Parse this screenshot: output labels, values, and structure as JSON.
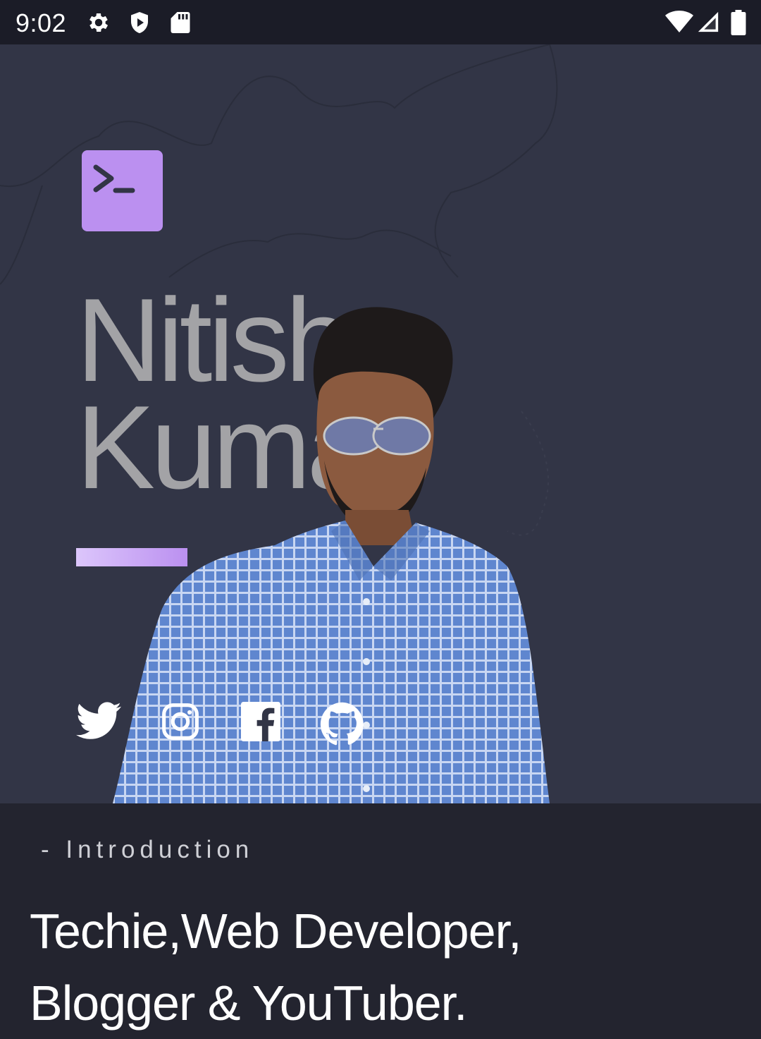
{
  "status_bar": {
    "time": "9:02",
    "icons": [
      "settings-icon",
      "shield-play-icon",
      "sd-card-icon",
      "wifi-icon",
      "signal-icon",
      "battery-icon"
    ]
  },
  "hero": {
    "logo_icon": "terminal-icon",
    "name_first": "Nitish",
    "name_last": "Kumar",
    "social_icons": [
      "twitter-icon",
      "instagram-icon",
      "facebook-icon",
      "github-icon"
    ]
  },
  "intro": {
    "label": "- Introduction",
    "headline_line1": "Techie,Web Developer,",
    "headline_line2": "Blogger & YouTuber."
  },
  "colors": {
    "hero_bg": "#323546",
    "page_bg": "#23242f",
    "accent": "#bb90f0",
    "name_text": "#a3a3a6"
  }
}
